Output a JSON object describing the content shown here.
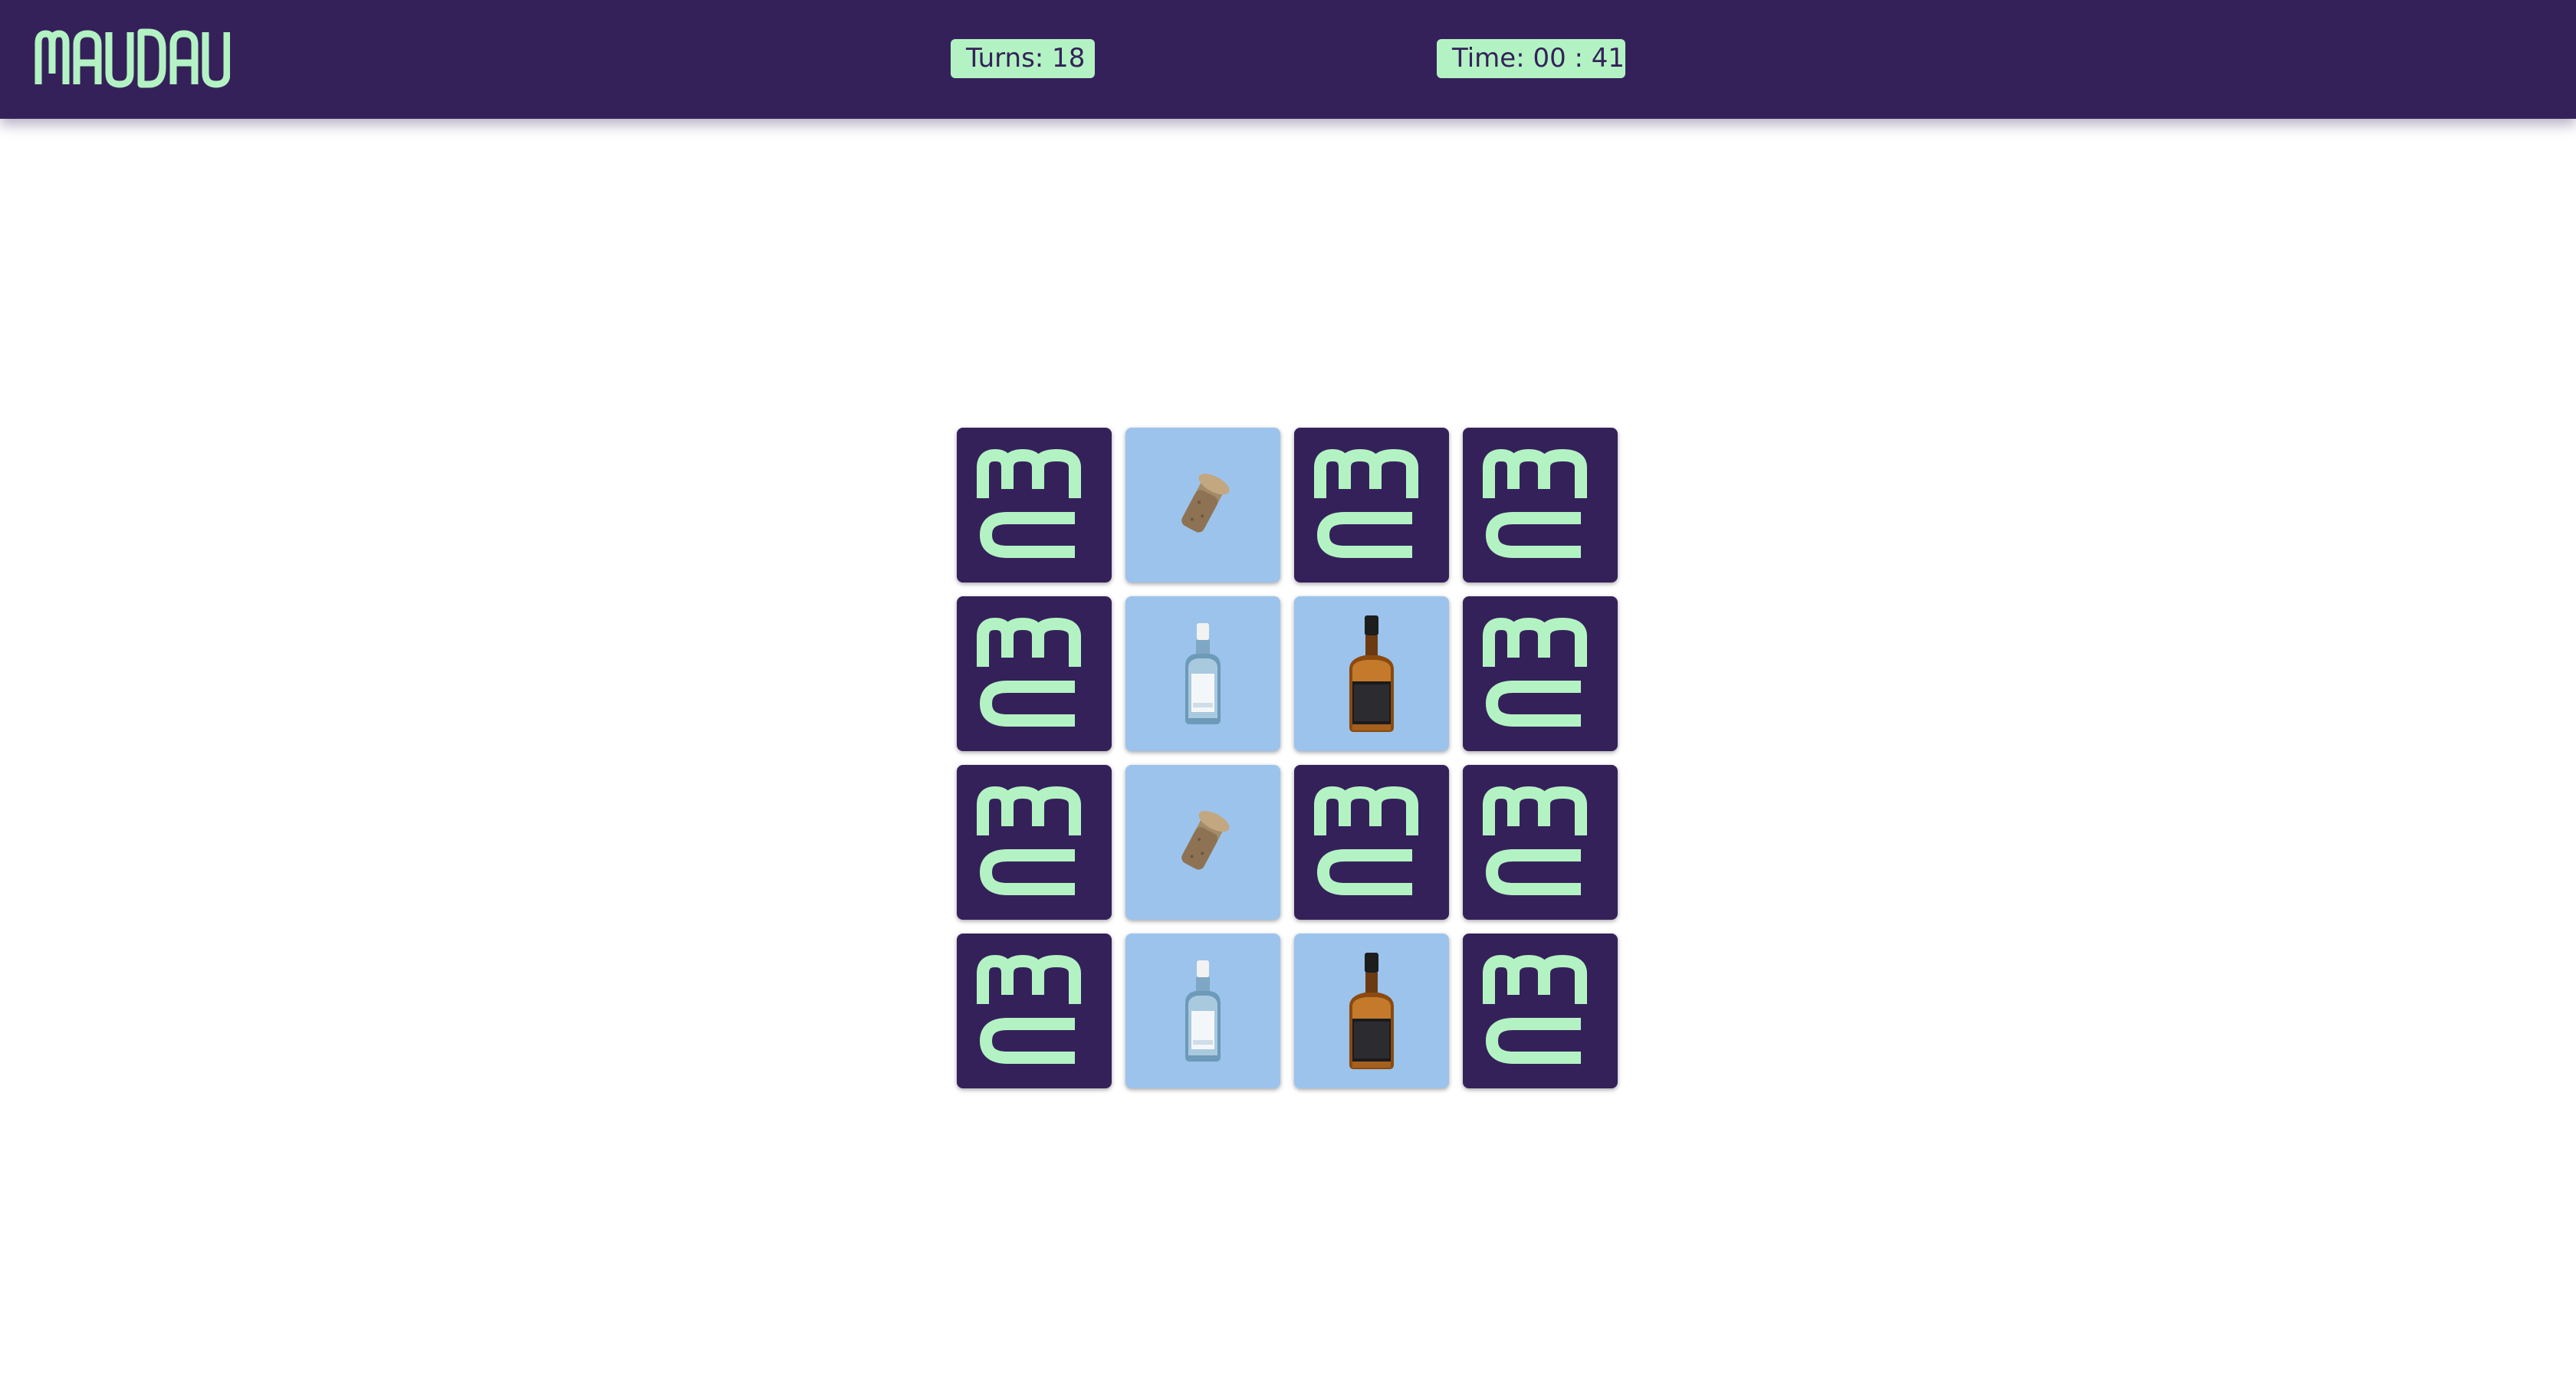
{
  "header": {
    "logo_text": "MAUDAU",
    "turns_label": "Turns: 18",
    "time_label": "Time: 00 : 41"
  },
  "colors": {
    "brand_purple": "#35215a",
    "accent_mint": "#b3f3c3",
    "card_face": "#9cc3ec"
  },
  "board": {
    "rows": 4,
    "columns": 4,
    "cards": [
      {
        "state": "face-down",
        "icon": "maudau-logo-icon"
      },
      {
        "state": "face-up",
        "icon": "cork-icon"
      },
      {
        "state": "face-down",
        "icon": "maudau-logo-icon"
      },
      {
        "state": "face-down",
        "icon": "maudau-logo-icon"
      },
      {
        "state": "face-down",
        "icon": "maudau-logo-icon"
      },
      {
        "state": "face-up",
        "icon": "gin-bottle-icon"
      },
      {
        "state": "face-up",
        "icon": "whiskey-bottle-icon"
      },
      {
        "state": "face-down",
        "icon": "maudau-logo-icon"
      },
      {
        "state": "face-down",
        "icon": "maudau-logo-icon"
      },
      {
        "state": "face-up",
        "icon": "cork-icon"
      },
      {
        "state": "face-down",
        "icon": "maudau-logo-icon"
      },
      {
        "state": "face-down",
        "icon": "maudau-logo-icon"
      },
      {
        "state": "face-down",
        "icon": "maudau-logo-icon"
      },
      {
        "state": "face-up",
        "icon": "gin-bottle-icon"
      },
      {
        "state": "face-up",
        "icon": "whiskey-bottle-icon"
      },
      {
        "state": "face-down",
        "icon": "maudau-logo-icon"
      }
    ]
  }
}
